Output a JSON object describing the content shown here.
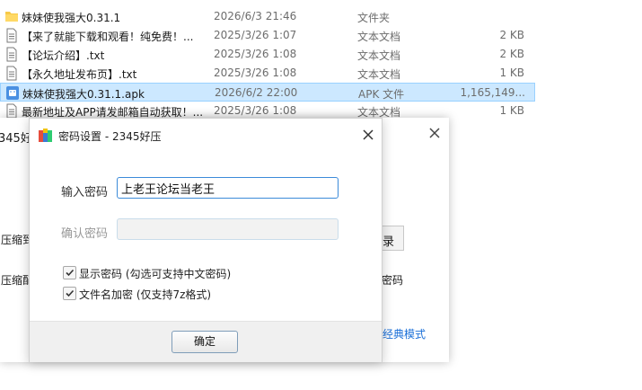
{
  "files": [
    {
      "icon": "folder-icon",
      "name": "妹妹使我强大0.31.1",
      "date": "2026/6/3 21:46",
      "type": "文件夹",
      "size": ""
    },
    {
      "icon": "text-file-icon",
      "name": "【来了就能下载和观看！纯免费！...",
      "date": "2025/3/26 1:07",
      "type": "文本文档",
      "size": "2 KB"
    },
    {
      "icon": "text-file-icon",
      "name": "【论坛介绍】.txt",
      "date": "2025/3/26 1:08",
      "type": "文本文档",
      "size": "2 KB"
    },
    {
      "icon": "text-file-icon",
      "name": "【永久地址发布页】.txt",
      "date": "2025/3/26 1:08",
      "type": "文本文档",
      "size": "1 KB"
    },
    {
      "icon": "apk-file-icon",
      "name": "妹妹使我强大0.31.1.apk",
      "date": "2026/6/2 22:00",
      "type": "APK 文件",
      "size": "1,165,149...",
      "selected": true
    },
    {
      "icon": "text-file-icon",
      "name": "最新地址及APP请发邮箱自动获取！...",
      "date": "2025/3/26 1:08",
      "type": "文本文档",
      "size": "1 KB"
    }
  ],
  "bg_window": {
    "title": "345好压",
    "label1": "压缩到",
    "label2": "压缩配",
    "button": "录",
    "right_text": "密码",
    "link": "经典模式"
  },
  "dialog": {
    "title": "密码设置 - 2345好压",
    "password_label": "输入密码",
    "password_value": "上老王论坛当老王",
    "confirm_label": "确认密码",
    "confirm_value": "",
    "show_password_label": "显示密码 (勾选可支持中文密码)",
    "show_password_checked": true,
    "encrypt_names_label": "文件名加密  (仅支持7z格式)",
    "encrypt_names_checked": true,
    "ok_label": "确定"
  },
  "colors": {
    "selection": "#cce8ff",
    "accent_border": "#3c8bd9",
    "link": "#1a6fd8",
    "folder": "#f7c948"
  }
}
